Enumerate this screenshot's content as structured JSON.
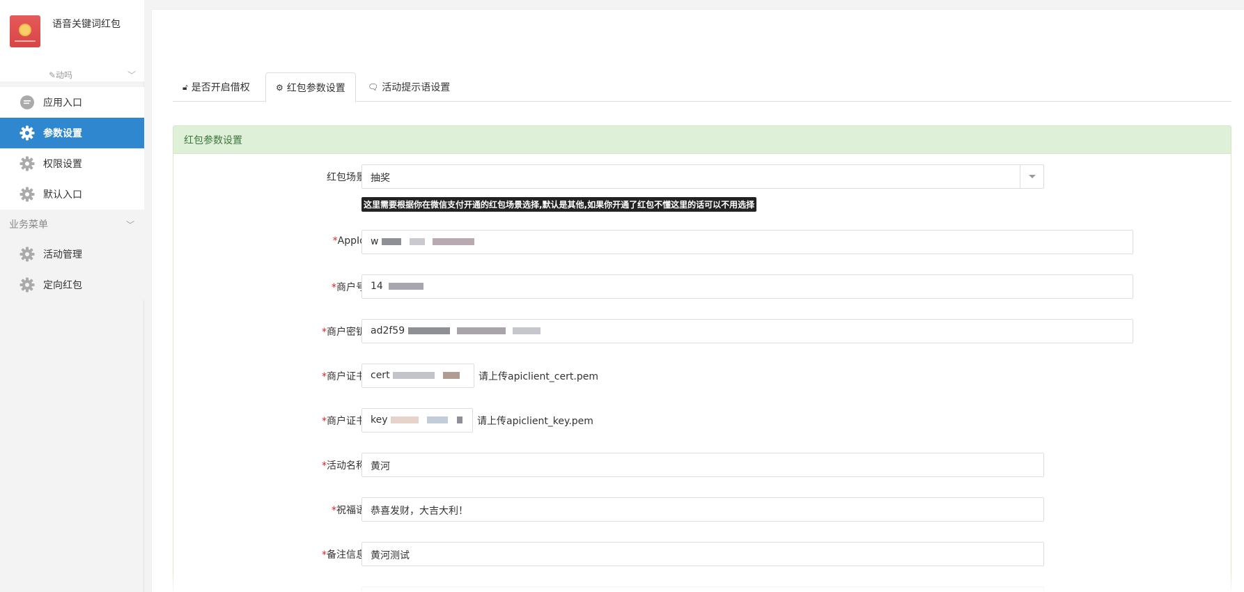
{
  "brand": {
    "name": "语音关键词红包",
    "user": "✎动吗"
  },
  "sidebar": {
    "items": [
      {
        "label": "应用入口",
        "icon": "chat-bubble-icon",
        "active": false
      },
      {
        "label": "参数设置",
        "icon": "gear-icon",
        "active": true
      },
      {
        "label": "权限设置",
        "icon": "gear-icon",
        "active": false
      },
      {
        "label": "默认入口",
        "icon": "gear-icon",
        "active": false
      }
    ],
    "group_title": "业务菜单",
    "group_items": [
      {
        "label": "活动管理",
        "icon": "gear-icon"
      },
      {
        "label": "定向红包",
        "icon": "gear-icon"
      }
    ]
  },
  "tabs": [
    {
      "label": "是否开启借权",
      "icon": "lock-icon"
    },
    {
      "label": "红包参数设置",
      "icon": "gear-icon",
      "active": true
    },
    {
      "label": "活动提示语设置",
      "icon": "comments-icon"
    }
  ],
  "panel": {
    "title": "红包参数设置",
    "scene": {
      "label": "红包场景",
      "value": "抽奖",
      "hint": "这里需要根据你在微信支付开通的红包场景选择,默认是其他,如果你开通了红包不懂这里的话可以不用选择"
    },
    "appid": {
      "label": "AppId",
      "value": "w"
    },
    "mch_id": {
      "label": "商户号",
      "value": "14"
    },
    "mch_key": {
      "label": "商户密钥",
      "value": "ad2f59"
    },
    "cert": {
      "label": "商户证书",
      "value": "cert",
      "note": "请上传apiclient_cert.pem"
    },
    "key": {
      "label": "商户证书",
      "value": "key",
      "note": "请上传apiclient_key.pem"
    },
    "act_name": {
      "label": "活动名称",
      "value": "黄河"
    },
    "wishing": {
      "label": "祝福语",
      "value": "恭喜发财，大吉大利！"
    },
    "remark": {
      "label": "备注信息",
      "value": "黄河测试"
    }
  },
  "colors": {
    "active_menu": "#2f88cf",
    "panel_head_bg": "#dff0d8",
    "panel_head_text": "#3c763d",
    "required": "#e02020"
  }
}
